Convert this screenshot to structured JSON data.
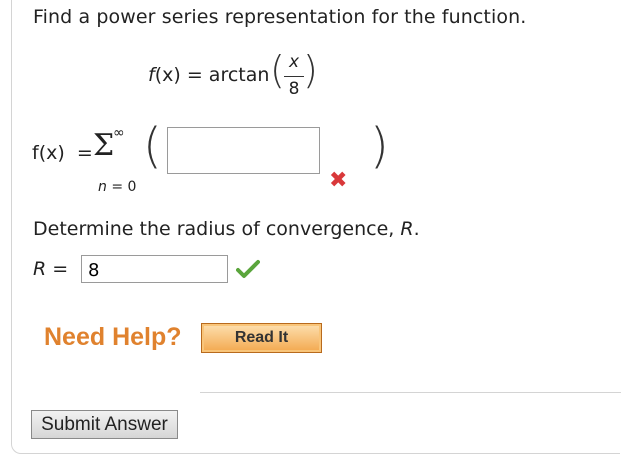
{
  "question": {
    "prompt": "Find a power series representation for the function.",
    "function_lhs_name": "f",
    "function_lhs_var": "(x)",
    "function_eq": "=",
    "function_name": "arctan",
    "frac_num": "x",
    "frac_den": "8"
  },
  "series": {
    "lhs": "f(x)",
    "eq": "=",
    "sigma": "Σ",
    "upper": "∞",
    "lower_var": "n",
    "lower_rest": " = 0",
    "answer_value": "",
    "status": "incorrect"
  },
  "radius": {
    "prompt_text": "Determine the radius of convergence, ",
    "prompt_var": "R",
    "prompt_end": ".",
    "label_var": "R",
    "label_eq": " =",
    "value": "8",
    "status": "correct"
  },
  "help": {
    "label": "Need Help?",
    "read_it": "Read It"
  },
  "submit_label": "Submit Answer",
  "colors": {
    "help_orange": "#e0822e",
    "incorrect_red": "#d9383a",
    "correct_green": "#5aa53c"
  },
  "icons": {
    "incorrect": "x-mark-icon",
    "correct": "checkmark-icon"
  }
}
